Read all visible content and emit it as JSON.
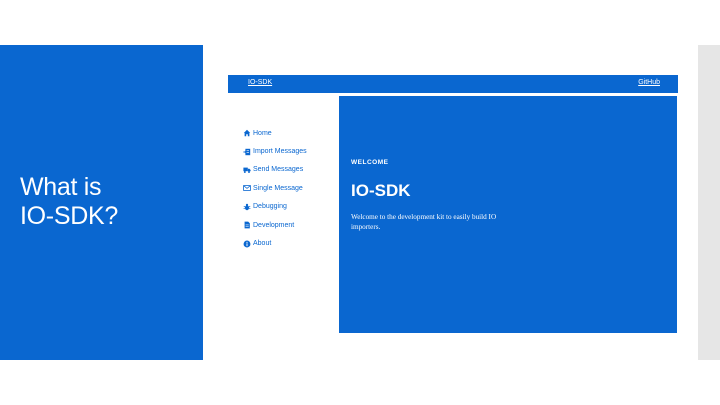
{
  "slide": {
    "title_line1": "What is",
    "title_line2": "IO-SDK?"
  },
  "app": {
    "navbar": {
      "brand": "IO-SDK",
      "github": "GitHub"
    },
    "sidebar": {
      "items": [
        {
          "label": "Home",
          "icon": "home-icon"
        },
        {
          "label": "Import Messages",
          "icon": "import-icon"
        },
        {
          "label": "Send Messages",
          "icon": "truck-icon"
        },
        {
          "label": "Single Message",
          "icon": "envelope-icon"
        },
        {
          "label": "Debugging",
          "icon": "bug-icon"
        },
        {
          "label": "Development",
          "icon": "file-icon"
        },
        {
          "label": "About",
          "icon": "info-icon"
        }
      ]
    },
    "hero": {
      "eyebrow": "WELCOME",
      "title": "IO-SDK",
      "text": "Welcome to the development kit to easily build IO importers."
    }
  },
  "colors": {
    "brand_blue": "#0a67d0",
    "scrollbar": "#e6e6e6"
  }
}
